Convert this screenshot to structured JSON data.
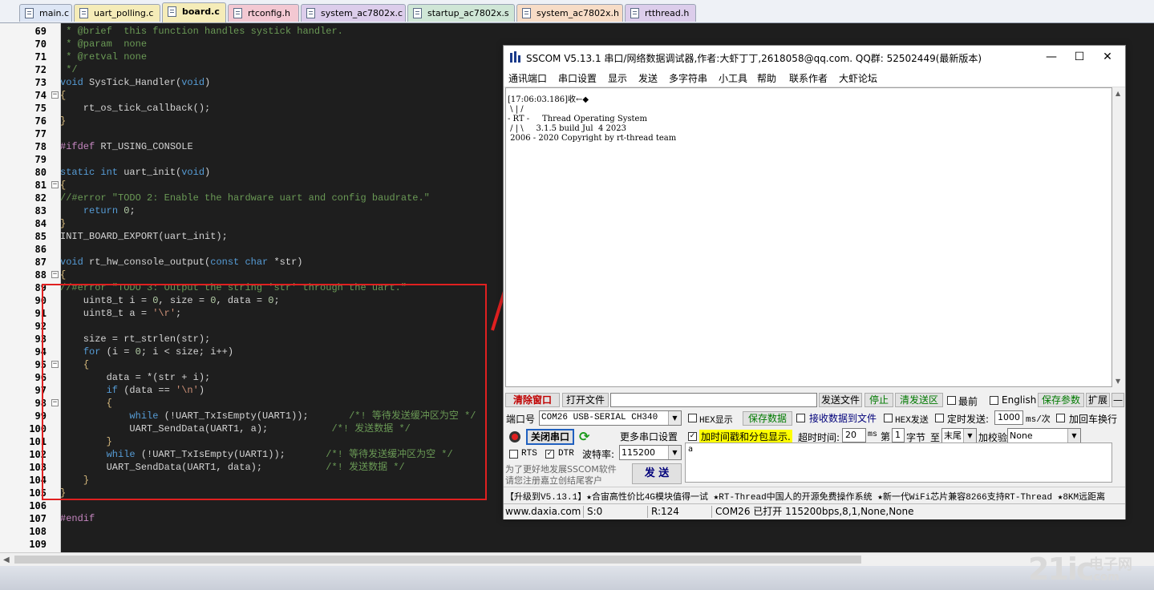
{
  "tabs": [
    {
      "label": "main.c",
      "color": "#dde6f5"
    },
    {
      "label": "uart_polling.c",
      "color": "#f5ecb8"
    },
    {
      "label": "board.c",
      "color": "#f5ecb8"
    },
    {
      "label": "rtconfig.h",
      "color": "#f3c8d2"
    },
    {
      "label": "system_ac7802x.c",
      "color": "#dccdeb"
    },
    {
      "label": "startup_ac7802x.s",
      "color": "#cfe6d6"
    },
    {
      "label": "system_ac7802x.h",
      "color": "#f7dcc6"
    },
    {
      "label": "rtthread.h",
      "color": "#dccdeb"
    }
  ],
  "active_tab": "board.c",
  "editor": {
    "line_numbers": [
      "69",
      "70",
      "71",
      "72",
      "73",
      "74",
      "75",
      "76",
      "77",
      "78",
      "79",
      "80",
      "81",
      "82",
      "83",
      "84",
      "85",
      "86",
      "87",
      "88",
      "89",
      "90",
      "91",
      "92",
      "93",
      "94",
      "95",
      "96",
      "97",
      "98",
      "99",
      "100",
      "101",
      "102",
      "103",
      "104",
      "105",
      "106",
      "107",
      "108",
      "109"
    ],
    "lines": [
      [
        [
          "c",
          " * @brief  this function handles systick handler."
        ]
      ],
      [
        [
          "c",
          " * @param  none"
        ]
      ],
      [
        [
          "c",
          " * @retval none"
        ]
      ],
      [
        [
          "c",
          " */"
        ]
      ],
      [
        [
          "k",
          "void"
        ],
        [
          "t",
          " SysTick_Handler("
        ],
        [
          "k",
          "void"
        ],
        [
          "t",
          ")"
        ]
      ],
      [
        [
          "p",
          "{"
        ]
      ],
      [
        [
          "t",
          "    rt_os_tick_callback();"
        ]
      ],
      [
        [
          "p",
          "}"
        ]
      ],
      [],
      [
        [
          "m",
          "#ifdef"
        ],
        [
          "t",
          " RT_USING_CONSOLE"
        ]
      ],
      [],
      [
        [
          "k",
          "static int"
        ],
        [
          "t",
          " uart_init("
        ],
        [
          "k",
          "void"
        ],
        [
          "t",
          ")"
        ]
      ],
      [
        [
          "p",
          "{"
        ]
      ],
      [
        [
          "c",
          "//#error \"TODO 2: Enable the hardware uart and config baudrate.\""
        ]
      ],
      [
        [
          "t",
          "    "
        ],
        [
          "k",
          "return"
        ],
        [
          "t",
          " "
        ],
        [
          "n",
          "0"
        ],
        [
          "t",
          ";"
        ]
      ],
      [
        [
          "p",
          "}"
        ]
      ],
      [
        [
          "t",
          "INIT_BOARD_EXPORT(uart_init);"
        ]
      ],
      [],
      [
        [
          "k",
          "void"
        ],
        [
          "t",
          " rt_hw_console_output("
        ],
        [
          "k",
          "const char"
        ],
        [
          "t",
          " *str)"
        ]
      ],
      [
        [
          "p",
          "{"
        ]
      ],
      [
        [
          "c",
          "//#error \"TODO 3: Output the string 'str' through the uart.\""
        ]
      ],
      [
        [
          "t",
          "    uint8_t i = "
        ],
        [
          "n",
          "0"
        ],
        [
          "t",
          ", size = "
        ],
        [
          "n",
          "0"
        ],
        [
          "t",
          ", data = "
        ],
        [
          "n",
          "0"
        ],
        [
          "t",
          ";"
        ]
      ],
      [
        [
          "t",
          "    uint8_t a = "
        ],
        [
          "s",
          "'\\r'"
        ],
        [
          "t",
          ";"
        ]
      ],
      [],
      [
        [
          "t",
          "    size = rt_strlen(str);"
        ]
      ],
      [
        [
          "t",
          "    "
        ],
        [
          "k",
          "for"
        ],
        [
          "t",
          " (i = "
        ],
        [
          "n",
          "0"
        ],
        [
          "t",
          "; i < size; i++)"
        ]
      ],
      [
        [
          "t",
          "    "
        ],
        [
          "p",
          "{"
        ]
      ],
      [
        [
          "t",
          "        data = *(str + i);"
        ]
      ],
      [
        [
          "t",
          "        "
        ],
        [
          "k",
          "if"
        ],
        [
          "t",
          " (data == "
        ],
        [
          "s",
          "'\\n'"
        ],
        [
          "t",
          ")"
        ]
      ],
      [
        [
          "t",
          "        "
        ],
        [
          "p",
          "{"
        ]
      ],
      [
        [
          "t",
          "            "
        ],
        [
          "k",
          "while"
        ],
        [
          "t",
          " (!UART_TxIsEmpty(UART1));       "
        ],
        [
          "c",
          "/*! 等待发送缓冲区为空 */"
        ]
      ],
      [
        [
          "t",
          "            UART_SendData(UART1, a);           "
        ],
        [
          "c",
          "/*! 发送数据 */"
        ]
      ],
      [
        [
          "t",
          "        "
        ],
        [
          "p",
          "}"
        ]
      ],
      [
        [
          "t",
          "        "
        ],
        [
          "k",
          "while"
        ],
        [
          "t",
          " (!UART_TxIsEmpty(UART1));       "
        ],
        [
          "c",
          "/*! 等待发送缓冲区为空 */"
        ]
      ],
      [
        [
          "t",
          "        UART_SendData(UART1, data);           "
        ],
        [
          "c",
          "/*! 发送数据 */"
        ]
      ],
      [
        [
          "t",
          "    "
        ],
        [
          "p",
          "}"
        ]
      ],
      [
        [
          "p",
          "}"
        ]
      ],
      [],
      [
        [
          "m",
          "#endif"
        ]
      ],
      [],
      []
    ]
  },
  "sscom": {
    "title": "SSCOM V5.13.1 串口/网络数据调试器,作者:大虾丁丁,2618058@qq.com. QQ群: 52502449(最新版本)",
    "window_buttons": {
      "minimize": "—",
      "maximize": "☐",
      "close": "✕"
    },
    "menu": [
      "通讯端口",
      "串口设置",
      "显示",
      "发送",
      "多字符串",
      "小工具",
      "帮助",
      "联系作者",
      "大虾论坛"
    ],
    "receive_text": "[17:06:03.186]收←◆\n \\ | /\n- RT -     Thread Operating System\n / | \\     3.1.5 build Jul  4 2023\n 2006 - 2020 Copyright by rt-thread team",
    "toolbar": {
      "clear_window": "清除窗口",
      "open_file": "打开文件",
      "file_path": "",
      "send_file": "发送文件",
      "stop": "停止",
      "clear_send": "清发送区",
      "topmost": "最前",
      "english": "English",
      "save_params": "保存参数",
      "expand": "扩展",
      "collapse": "—"
    },
    "port_row": {
      "port_label": "端口号",
      "port_value": "COM26 USB-SERIAL CH340",
      "hex_display": "HEX显示",
      "save_data": "保存数据",
      "recv_to_file": "接收数据到文件",
      "hex_send": "HEX发送",
      "timed_send": "定时发送:",
      "interval_value": "1000",
      "interval_unit": "ms/次",
      "add_crlf": "加回车换行"
    },
    "row3": {
      "close_port": "关闭串口",
      "more_settings": "更多串口设置",
      "timestamp": "加时间戳和分包显示.",
      "timeout_label": "超时时间:",
      "timeout_value": "20",
      "timeout_unit": "ms",
      "nth_label": "第",
      "nth_value": "1",
      "byte_label": "字节",
      "to_label": "至",
      "end_value": "末尾",
      "checksum_label": "加校验",
      "checksum_value": "None"
    },
    "row4": {
      "rts": "RTS",
      "dtr": "DTR",
      "baud_label": "波特率:",
      "baud_value": "115200"
    },
    "promo_line1": "为了更好地发展SSCOM软件",
    "promo_line2": "请您注册嘉立创结尾客户",
    "send_button": "发 送",
    "send_text": "a",
    "ticker": "【升级到V5.13.1】★合宙高性价比4G模块值得一试 ★RT-Thread中国人的开源免费操作系统 ★新一代WiFi芯片兼容8266支持RT-Thread ★8KM远距离",
    "status": {
      "site": "www.daxia.com",
      "sent": "S:0",
      "received": "R:124",
      "port_state": "COM26 已打开  115200bps,8,1,None,None"
    }
  },
  "watermark": {
    "big": "21ic",
    "cn": "电子网",
    "domain": ".com"
  },
  "colors": {
    "highlight_box": "#e02020",
    "editor_bg": "#1e1e1e",
    "clear_btn_text": "#c00000",
    "green_btn_text": "#007a00",
    "timestamp_bg": "#ffff00"
  }
}
